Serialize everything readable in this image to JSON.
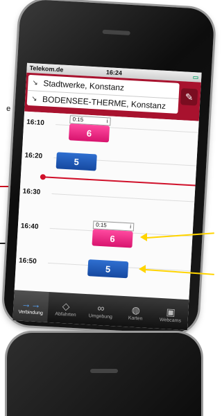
{
  "annotations": {
    "left_text": "e r"
  },
  "status": {
    "carrier": "Telekom.de",
    "time": "16:24",
    "battery": "▭"
  },
  "route": {
    "from": "Stadtwerke, Konstanz",
    "to": "BODENSEE-THERME, Konstanz"
  },
  "timeline": {
    "times": [
      "16:10",
      "16:20",
      "16:30",
      "16:40",
      "16:50"
    ],
    "trips": [
      {
        "tag": "0:15",
        "info": "i",
        "line": "6",
        "color": "pink"
      },
      {
        "tag": "",
        "info": "",
        "line": "5",
        "color": "blue"
      },
      {
        "tag": "0:15",
        "info": "i",
        "line": "6",
        "color": "pink"
      },
      {
        "tag": "",
        "info": "",
        "line": "5",
        "color": "blue"
      }
    ]
  },
  "tabs": [
    {
      "label": "Verbindung",
      "icon": "route-icon",
      "glyph": "→→",
      "active": true
    },
    {
      "label": "Abfahrten",
      "icon": "departures-icon",
      "glyph": "◇",
      "active": false
    },
    {
      "label": "Umgebung",
      "icon": "binoculars-icon",
      "glyph": "∞",
      "active": false
    },
    {
      "label": "Karten",
      "icon": "map-icon",
      "glyph": "◍",
      "active": false
    },
    {
      "label": "Webcams",
      "icon": "camera-icon",
      "glyph": "▣",
      "active": false
    }
  ],
  "colors": {
    "accent": "#a8122e",
    "pink": "#e01a78",
    "blue": "#1e56b0",
    "now": "#d0102a",
    "annotation_yellow": "#ffd400"
  }
}
